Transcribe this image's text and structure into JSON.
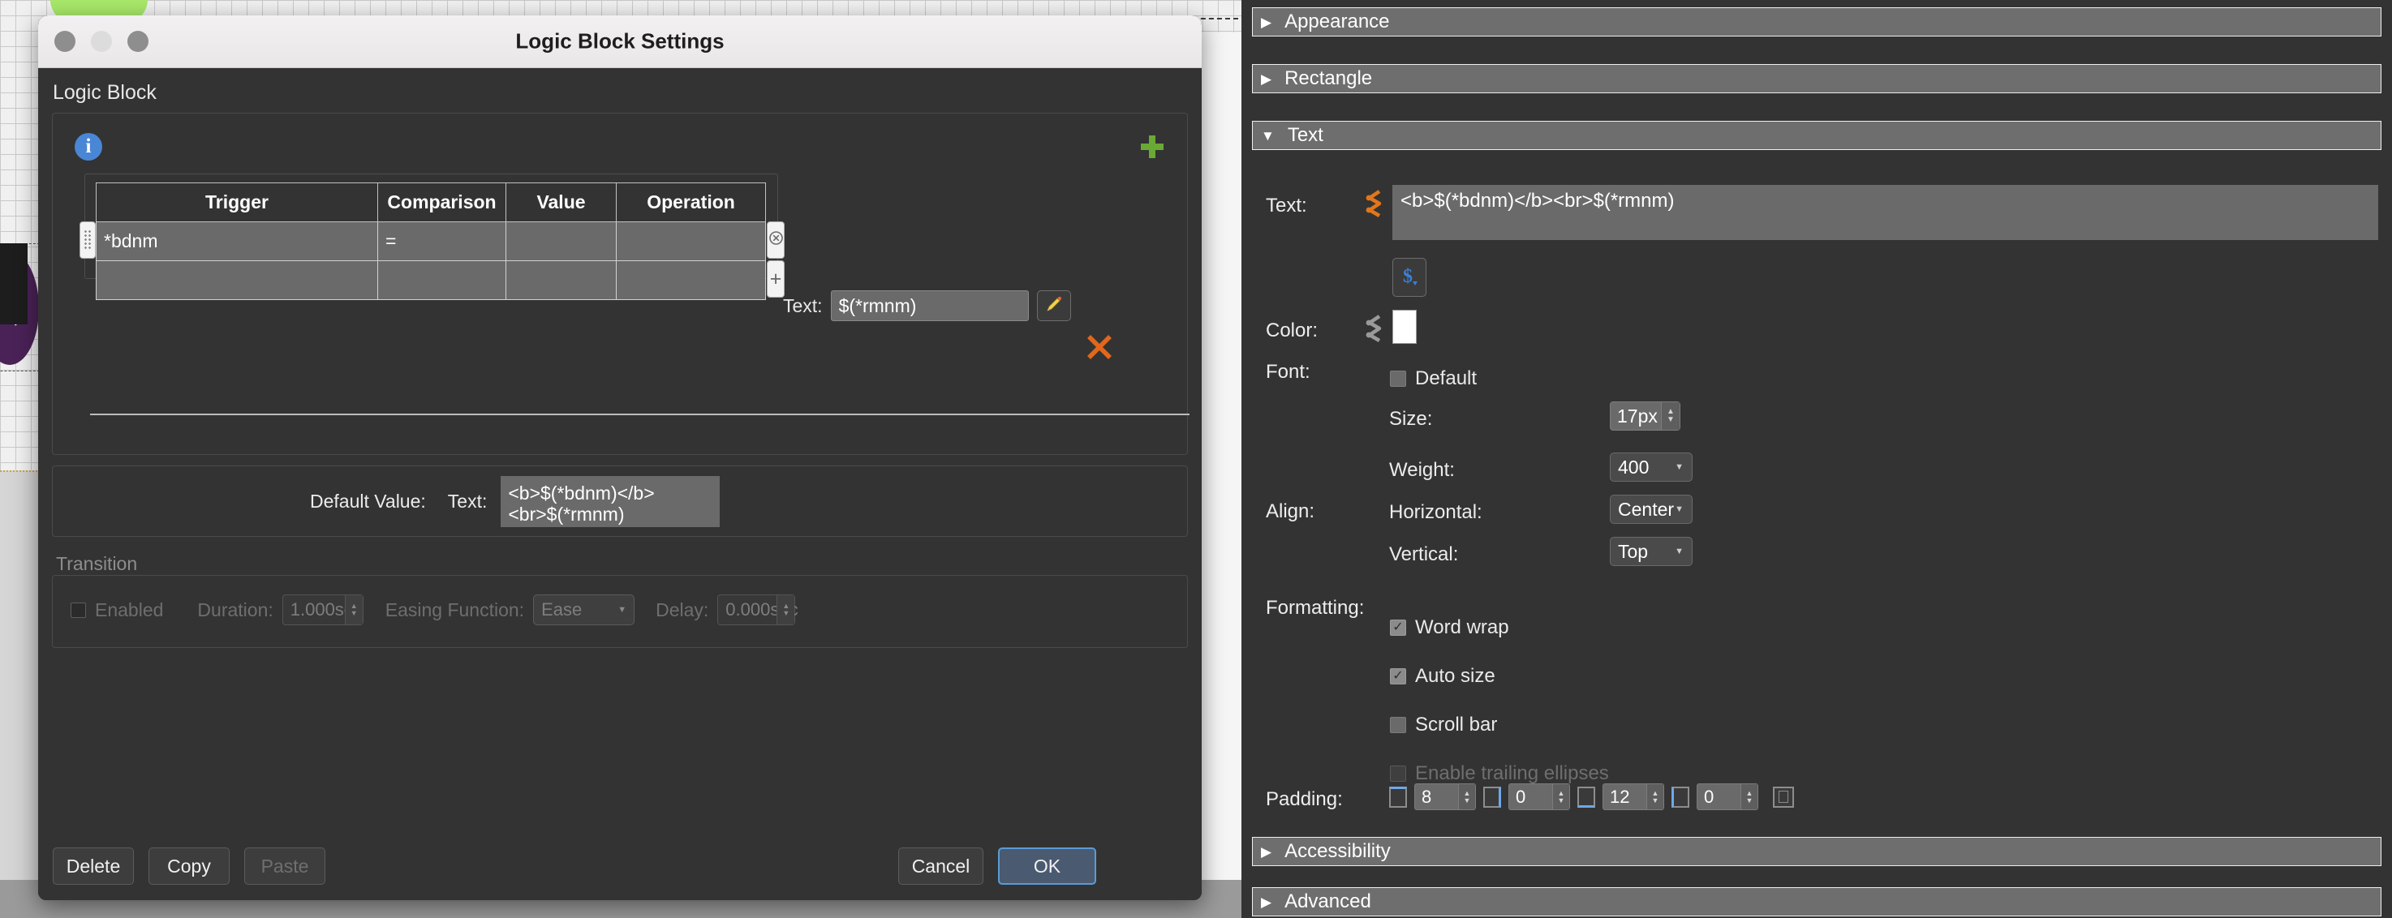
{
  "window": {
    "title": "Logic Block Settings",
    "traffic_lights": [
      "close-button",
      "minimize-button",
      "zoom-button"
    ]
  },
  "dialog": {
    "section_label": "Logic Block",
    "info_icon": "i",
    "add_row_icon": "plus-icon",
    "delete_row_icon": "x-icon",
    "table": {
      "headers": [
        "Trigger",
        "Comparison",
        "Value",
        "Operation"
      ],
      "rows": [
        {
          "trigger": "*bdnm",
          "comparison": "=",
          "value": "",
          "operation": ""
        },
        {
          "trigger": "",
          "comparison": "",
          "value": "",
          "operation": ""
        }
      ],
      "row_close_icon": "⊗",
      "row_add_icon": "+"
    },
    "inner_text": {
      "label": "Text:",
      "value": "$(*rmnm)",
      "edit_icon": "pencil-icon"
    },
    "default_value": {
      "label": "Default Value:",
      "text_label": "Text:",
      "value": "<b>$(*bdnm)</b><br>$(*rmnm)"
    },
    "transition": {
      "title": "Transition",
      "enabled_label": "Enabled",
      "enabled_checked": false,
      "duration_label": "Duration:",
      "duration_value": "1.000sec",
      "easing_label": "Easing Function:",
      "easing_value": "Ease",
      "delay_label": "Delay:",
      "delay_value": "0.000sec"
    },
    "footer": {
      "delete": "Delete",
      "copy": "Copy",
      "paste": "Paste",
      "cancel": "Cancel",
      "ok": "OK"
    }
  },
  "inspector": {
    "accordions": [
      {
        "label": "Appearance",
        "expanded": false,
        "triangle": "▶"
      },
      {
        "label": "Rectangle",
        "expanded": false,
        "triangle": "▶"
      },
      {
        "label": "Text",
        "expanded": true,
        "triangle": "▼"
      },
      {
        "label": "Accessibility",
        "expanded": false,
        "triangle": "▶"
      },
      {
        "label": "Advanced",
        "expanded": false,
        "triangle": "▶"
      }
    ],
    "text": {
      "label": "Text:",
      "value": "<b>$(*bdnm)</b><br>$(*rmnm)",
      "link_icon": "link-orange-icon",
      "variable_icon": "dollar-icon",
      "fit_icon": "fit-vertical-icon",
      "edit_icon": "pencil-icon"
    },
    "color": {
      "label": "Color:",
      "link_icon": "link-gray-icon",
      "swatch_hex": "#ffffff"
    },
    "font": {
      "label": "Font:",
      "default_label": "Default",
      "default_checked": false,
      "size_label": "Size:",
      "size_value": "17px",
      "weight_label": "Weight:",
      "weight_value": "400"
    },
    "align": {
      "label": "Align:",
      "horizontal_label": "Horizontal:",
      "horizontal_value": "Center",
      "vertical_label": "Vertical:",
      "vertical_value": "Top"
    },
    "formatting": {
      "label": "Formatting:",
      "items": [
        {
          "label": "Word wrap",
          "checked": true,
          "disabled": false
        },
        {
          "label": "Auto size",
          "checked": true,
          "disabled": false
        },
        {
          "label": "Scroll bar",
          "checked": false,
          "disabled": false
        },
        {
          "label": "Enable trailing ellipses",
          "checked": false,
          "disabled": true
        }
      ]
    },
    "padding": {
      "label": "Padding:",
      "values": [
        "8",
        "0",
        "12",
        "0"
      ],
      "icons": [
        "padding-top-icon",
        "padding-right-icon",
        "padding-bottom-icon",
        "padding-left-icon"
      ],
      "all_icon": "padding-all-icon"
    }
  },
  "colors": {
    "accent_blue": "#5b9bd5",
    "add_green": "#6aaa34",
    "delete_orange": "#e2661b",
    "panel_bg": "#333333",
    "header_gray": "#6e6e6e"
  }
}
